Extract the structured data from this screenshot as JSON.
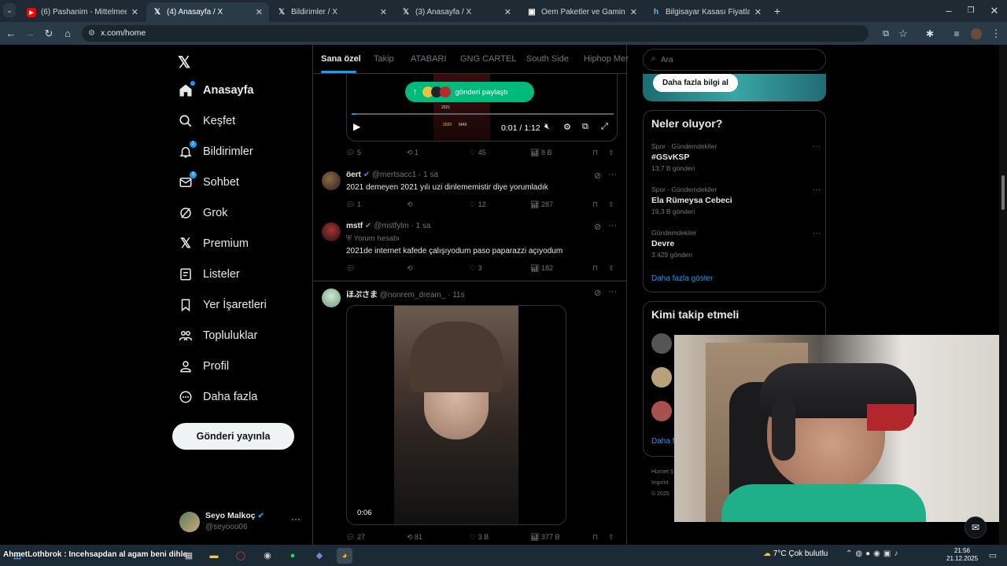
{
  "browser": {
    "tabs": [
      {
        "title": "(6) Pashanim - Mittelmeer - Yo",
        "icon": "youtube-icon",
        "color": "#ff0000"
      },
      {
        "title": "(4) Anasayfa / X",
        "icon": "x-icon",
        "active": true
      },
      {
        "title": "Bildirimler / X",
        "icon": "x-icon"
      },
      {
        "title": "(3) Anasayfa / X",
        "icon": "x-icon"
      },
      {
        "title": "Oem Paketler ve Gaming Bilgisa",
        "icon": "shop-icon"
      },
      {
        "title": "Bilgisayar Kasası Fiyatları & PC",
        "icon": "shop-icon"
      }
    ],
    "url": "x.com/home"
  },
  "sidebar": {
    "items": [
      {
        "label": "Anasayfa",
        "icon": "home-icon"
      },
      {
        "label": "Keşfet",
        "icon": "search-icon"
      },
      {
        "label": "Bildirimler",
        "icon": "bell-icon",
        "badge": "1"
      },
      {
        "label": "Sohbet",
        "icon": "mail-icon",
        "badge": "3"
      },
      {
        "label": "Grok",
        "icon": "grok-icon"
      },
      {
        "label": "Premium",
        "icon": "x-icon"
      },
      {
        "label": "Listeler",
        "icon": "list-icon"
      },
      {
        "label": "Yer İşaretleri",
        "icon": "bookmark-icon"
      },
      {
        "label": "Topluluklar",
        "icon": "communities-icon"
      },
      {
        "label": "Profil",
        "icon": "profile-icon"
      },
      {
        "label": "Daha fazla",
        "icon": "more-icon"
      }
    ],
    "post_button": "Gönderi yayınla",
    "account": {
      "name": "Seyo Malkoç",
      "handle": "@seyooo06"
    }
  },
  "feed": {
    "tabs": [
      "Sana özel",
      "Takip",
      "ATABARI",
      "GNG CARTEL",
      "South Side",
      "Hiphop Mer"
    ],
    "video1": {
      "share_pill": "gönderi paylaştı",
      "time": "0:01 / 1:12",
      "overlay_texts": [
        "2021",
        "2020",
        "MAK"
      ]
    },
    "post1_actions": {
      "replies": "5",
      "reposts": "1",
      "likes": "45",
      "views": "8 B"
    },
    "reply1": {
      "name": "öert",
      "handle": "@mertsacc1",
      "time": "· 1 sa",
      "text": "2021 demeyen 2021 yılı uzi dinlememistir diye yorumladık",
      "replies": "1",
      "reposts": "",
      "likes": "12",
      "views": "287"
    },
    "reply2": {
      "name": "mstf",
      "handle": "@mstfylm",
      "time": "· 1 sa",
      "sub": "Yorum hesabı",
      "text": "2021de internet kafede çalışıyodum paso paparazzi açıyodum",
      "replies": "",
      "reposts": "",
      "likes": "3",
      "views": "182"
    },
    "post2": {
      "name": "ほぷさま",
      "handle": "@nonrem_dream_",
      "time": "· 11s",
      "video_time": "0:06",
      "replies": "27",
      "reposts": "81",
      "likes": "3 B",
      "views": "377 B"
    }
  },
  "right": {
    "search_placeholder": "Ara",
    "promo_button": "Daha fazla bilgi al",
    "trends_title": "Neler oluyor?",
    "trends": [
      {
        "category": "Spor · Gündemdekiler",
        "name": "#GSvKSP",
        "count": "13,7 B gönderi"
      },
      {
        "category": "Spor · Gündemdekiler",
        "name": "Ela Rümeysa Cebeci",
        "count": "19,3 B gönderi"
      },
      {
        "category": "Gündemdekiler",
        "name": "Devre",
        "count": "3.429 gönderi"
      }
    ],
    "show_more": "Daha fazla göster",
    "who_to_follow": "Kimi takip etmeli",
    "who_more": "Daha f",
    "footer": [
      "Hizmet Ş",
      "Imprint",
      "© 2025"
    ]
  },
  "taskbar": {
    "ticker": "AhmetLothbrok : Incehsapdan al agam beni dihle",
    "weather": "7°C  Çok bulutlu",
    "time": "21:56",
    "date": "21.12.2025"
  },
  "colors": {
    "accent": "#1d9bf0",
    "green_pill": "#00ba7c",
    "page_bg": "#000000",
    "text": "#e7e9ea",
    "muted": "#71767b"
  }
}
